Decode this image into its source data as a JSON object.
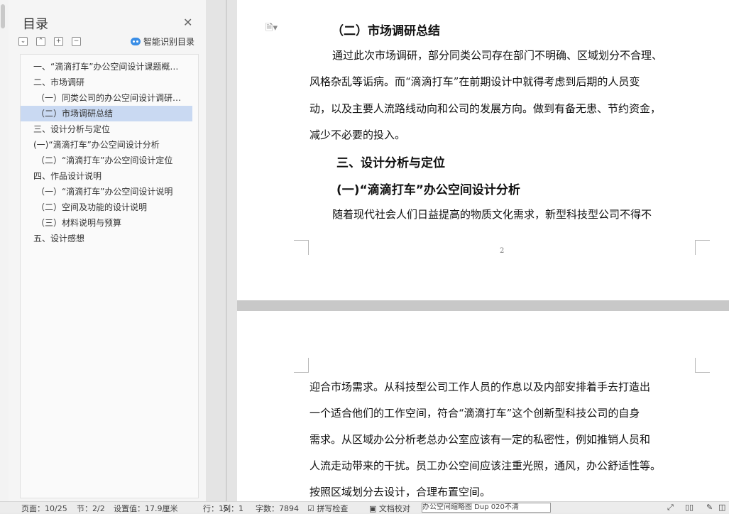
{
  "toc": {
    "title": "目录",
    "close_icon": "close-icon",
    "smart_label": "智能识别目录",
    "tools": [
      "collapse-icon",
      "expand-icon",
      "add-icon",
      "remove-icon"
    ],
    "items": [
      {
        "label": "一、“滴滴打车”办公空间设计课题概…",
        "selected": false
      },
      {
        "label": "二、市场调研",
        "selected": false
      },
      {
        "label": "（一）同类公司的办公空间设计调研…",
        "selected": false
      },
      {
        "label": "（二）市场调研总结",
        "selected": true
      },
      {
        "label": "三、设计分析与定位",
        "selected": false
      },
      {
        "label": "(一)“滴滴打车”办公空间设计分析",
        "selected": false
      },
      {
        "label": "（二）“滴滴打车”办公空间设计定位",
        "selected": false
      },
      {
        "label": "四、作品设计说明",
        "selected": false
      },
      {
        "label": "（一）“滴滴打车”办公空间设计说明",
        "selected": false
      },
      {
        "label": "（二）空间及功能的设计说明",
        "selected": false
      },
      {
        "label": "（三）材料说明与预算",
        "selected": false
      },
      {
        "label": "五、设计感想",
        "selected": false
      }
    ]
  },
  "document": {
    "page1": {
      "heading1": "（二）市场调研总结",
      "para1": [
        "通过此次市场调研，部分同类公司存在部门不明确、区域划分不合理、",
        "风格杂乱等诟病。而“滴滴打车”在前期设计中就得考虑到后期的人员变",
        "动，以及主要人流路线动向和公司的发展方向。做到有备无患、节约资金，",
        "减少不必要的投入。"
      ],
      "heading2": "三、设计分析与定位",
      "heading3": "(一)“滴滴打车”办公空间设计分析",
      "para2": "随着现代社会人们日益提高的物质文化需求，新型科技型公司不得不",
      "page_number": "2"
    },
    "page2": {
      "lines": [
        "迎合市场需求。从科技型公司工作人员的作息以及内部安排着手去打造出",
        "一个适合他们的工作空间，符合“滴滴打车”这个创新型科技公司的自身",
        "需求。从区域办公分析老总办公室应该有一定的私密性，例如推销人员和",
        "人流走动带来的干扰。员工办公空间应该注重光照，通风，办公舒适性等。",
        "按照区域划分去设计，合理布置空间。"
      ]
    }
  },
  "statusbar": {
    "page": "页面：10/25",
    "section": "节：2/2",
    "setting": "设置值：17.9厘米",
    "row": "行：15",
    "col": "列：1",
    "wordcount": "字数：7894",
    "spellcheck": "拼写检查",
    "doc_check": "文档校对",
    "search_box": "办公空间缩略图 Dup 020不清"
  }
}
